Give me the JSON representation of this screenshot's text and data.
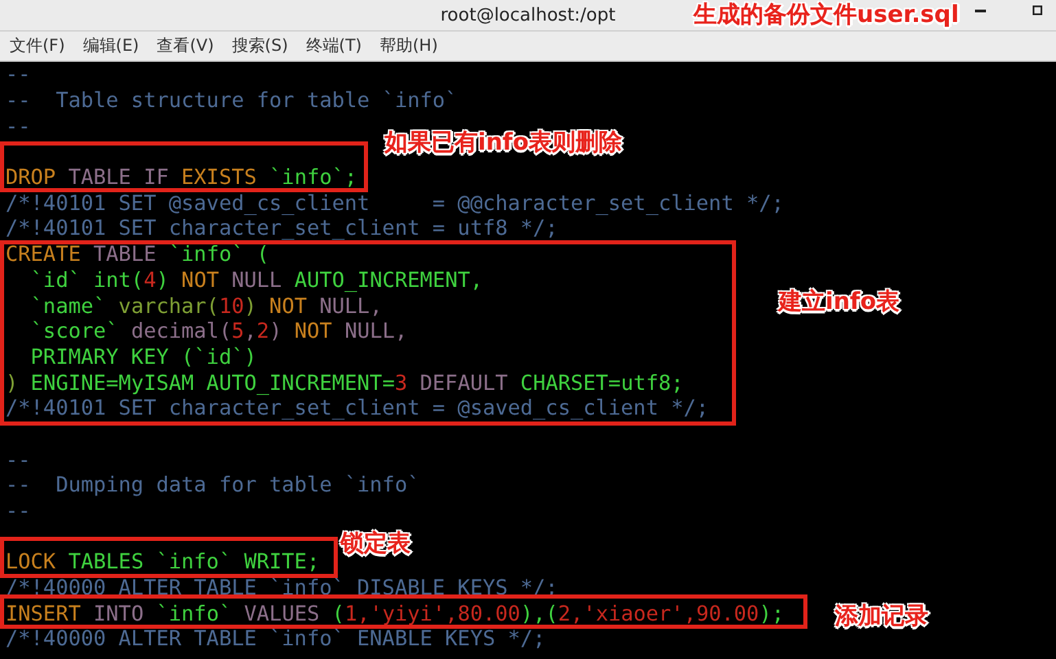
{
  "window": {
    "title": "root@localhost:/opt"
  },
  "menu": [
    {
      "label": "文件(F)"
    },
    {
      "label": "编辑(E)"
    },
    {
      "label": "查看(V)"
    },
    {
      "label": "搜索(S)"
    },
    {
      "label": "终端(T)"
    },
    {
      "label": "帮助(H)"
    }
  ],
  "terminal": {
    "lines": [
      {
        "kind": "code",
        "segments": [
          {
            "kind": "comment",
            "text": "--"
          }
        ]
      },
      {
        "kind": "code",
        "segments": [
          {
            "kind": "comment",
            "text": "--  Table structure for table `info`"
          }
        ]
      },
      {
        "kind": "code",
        "segments": [
          {
            "kind": "comment",
            "text": "--"
          }
        ]
      },
      {
        "kind": "blank"
      },
      {
        "kind": "code",
        "segments": [
          {
            "kind": "keyword",
            "text": "DROP"
          },
          {
            "kind": "plain",
            "text": " TABLE IF "
          },
          {
            "kind": "keyword",
            "text": "EXISTS"
          },
          {
            "kind": "ident",
            "text": " `info`;"
          }
        ]
      },
      {
        "kind": "code",
        "segments": [
          {
            "kind": "comment",
            "text": "/*!40101 SET @saved_cs_client     = @@character_set_client */;"
          }
        ]
      },
      {
        "kind": "code",
        "segments": [
          {
            "kind": "comment",
            "text": "/*!40101 SET character_set_client = utf8 */;"
          }
        ]
      },
      {
        "kind": "code",
        "segments": [
          {
            "kind": "keyword",
            "text": "CREATE"
          },
          {
            "kind": "plain",
            "text": " TABLE "
          },
          {
            "kind": "ident",
            "text": "`info` ("
          }
        ]
      },
      {
        "kind": "code",
        "segments": [
          {
            "kind": "ident",
            "text": "  `id` int("
          },
          {
            "kind": "number",
            "text": "4"
          },
          {
            "kind": "ident",
            "text": ") "
          },
          {
            "kind": "keyword",
            "text": "NOT"
          },
          {
            "kind": "plain",
            "text": " NULL "
          },
          {
            "kind": "ident",
            "text": "AUTO_INCREMENT,"
          }
        ]
      },
      {
        "kind": "code",
        "segments": [
          {
            "kind": "ident",
            "text": "  `name` "
          },
          {
            "kind": "type",
            "text": "varchar("
          },
          {
            "kind": "number",
            "text": "10"
          },
          {
            "kind": "type",
            "text": ") "
          },
          {
            "kind": "keyword",
            "text": "NOT"
          },
          {
            "kind": "plain",
            "text": " NULL,"
          }
        ]
      },
      {
        "kind": "code",
        "segments": [
          {
            "kind": "ident",
            "text": "  `score` "
          },
          {
            "kind": "plain",
            "text": "decimal("
          },
          {
            "kind": "number",
            "text": "5"
          },
          {
            "kind": "plain",
            "text": ","
          },
          {
            "kind": "number",
            "text": "2"
          },
          {
            "kind": "plain",
            "text": ") "
          },
          {
            "kind": "keyword",
            "text": "NOT"
          },
          {
            "kind": "plain",
            "text": " NULL,"
          }
        ]
      },
      {
        "kind": "code",
        "segments": [
          {
            "kind": "ident",
            "text": "  PRIMARY KEY (`id`)"
          }
        ]
      },
      {
        "kind": "code",
        "segments": [
          {
            "kind": "type",
            "text": ")"
          },
          {
            "kind": "ident",
            "text": " ENGINE=MyISAM AUTO_INCREMENT="
          },
          {
            "kind": "number",
            "text": "3"
          },
          {
            "kind": "plain",
            "text": " DEFAULT "
          },
          {
            "kind": "ident",
            "text": "CHARSET=utf8;"
          }
        ]
      },
      {
        "kind": "code",
        "segments": [
          {
            "kind": "comment",
            "text": "/*!40101 SET character_set_client = @saved_cs_client */;"
          }
        ]
      },
      {
        "kind": "blank"
      },
      {
        "kind": "code",
        "segments": [
          {
            "kind": "comment",
            "text": "--"
          }
        ]
      },
      {
        "kind": "code",
        "segments": [
          {
            "kind": "comment",
            "text": "--  Dumping data for table `info`"
          }
        ]
      },
      {
        "kind": "code",
        "segments": [
          {
            "kind": "comment",
            "text": "--"
          }
        ]
      },
      {
        "kind": "blank"
      },
      {
        "kind": "code",
        "segments": [
          {
            "kind": "keyword",
            "text": "LOCK"
          },
          {
            "kind": "ident",
            "text": " TABLES `info` WRITE;"
          }
        ]
      },
      {
        "kind": "code",
        "segments": [
          {
            "kind": "comment",
            "text": "/*!40000 ALTER TABLE `info` DISABLE KEYS */;"
          }
        ]
      },
      {
        "kind": "code",
        "segments": [
          {
            "kind": "keyword",
            "text": "INSERT"
          },
          {
            "kind": "plain",
            "text": " INTO "
          },
          {
            "kind": "ident",
            "text": "`info`"
          },
          {
            "kind": "plain",
            "text": " VALUES "
          },
          {
            "kind": "ident",
            "text": "("
          },
          {
            "kind": "number",
            "text": "1,'yiyi',80.00"
          },
          {
            "kind": "ident",
            "text": "),("
          },
          {
            "kind": "number",
            "text": "2,'xiaoer',90.00"
          },
          {
            "kind": "ident",
            "text": ");"
          }
        ]
      },
      {
        "kind": "code",
        "segments": [
          {
            "kind": "comment",
            "text": "/*!40000 ALTER TABLE `info` ENABLE KEYS */;"
          }
        ]
      }
    ]
  },
  "annotations": [
    {
      "kind": "title",
      "text": "生成的备份文件user.sql"
    },
    {
      "kind": "drop",
      "text": "如果已有info表则删除"
    },
    {
      "kind": "create",
      "text": "建立info表"
    },
    {
      "kind": "lock",
      "text": "锁定表"
    },
    {
      "kind": "insert",
      "text": "添加记录"
    }
  ]
}
